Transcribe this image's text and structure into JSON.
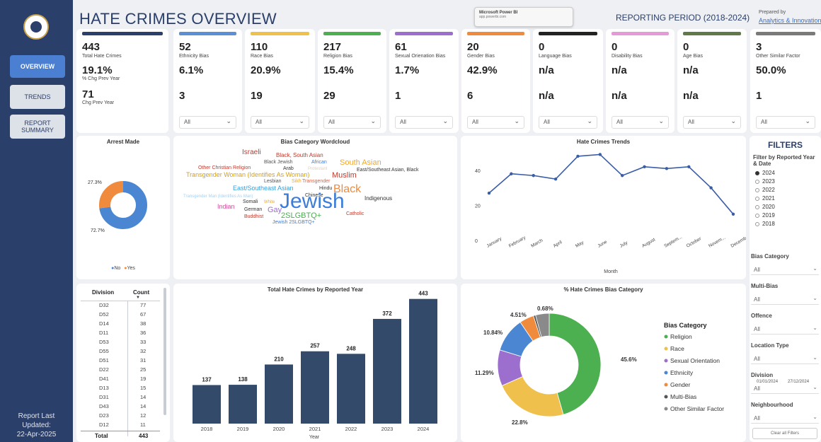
{
  "header": {
    "title": "HATE CRIMES OVERVIEW",
    "reporting_period": "REPORTING PERIOD (2018-2024)",
    "prepared_by": "Prepared by",
    "prepared_link": "Analytics & Innovation",
    "popup_title": "Microsoft Power BI",
    "popup_url": "app.powerbi.com"
  },
  "sidebar": {
    "nav": [
      {
        "label": "OVERVIEW",
        "active": true
      },
      {
        "label": "TRENDS",
        "active": false
      },
      {
        "label": "REPORT SUMMARY",
        "active": false
      }
    ],
    "updated_label": "Report Last Updated:",
    "updated_date": "22-Apr-2025"
  },
  "kpis": [
    {
      "count": "443",
      "label": "Total Hate Crimes",
      "pct": "19.1%",
      "pct_label": "% Chg Prev Year",
      "chg": "71",
      "chg_label": "Chg Prev Year",
      "color": "#2b3f6b",
      "dropdown": ""
    },
    {
      "count": "52",
      "label": "Ethnicity Bias",
      "pct": "6.1%",
      "chg": "3",
      "color": "#5b8fd6",
      "dropdown": "All"
    },
    {
      "count": "110",
      "label": "Race Bias",
      "pct": "20.9%",
      "chg": "19",
      "color": "#f0c04c",
      "dropdown": "All"
    },
    {
      "count": "217",
      "label": "Religion Bias",
      "pct": "15.4%",
      "chg": "29",
      "color": "#4caf50",
      "dropdown": "All"
    },
    {
      "count": "61",
      "label": "Sexual Orienation Bias",
      "pct": "1.7%",
      "chg": "1",
      "color": "#9c6fcf",
      "dropdown": "All"
    },
    {
      "count": "20",
      "label": "Gender Bias",
      "pct": "42.9%",
      "chg": "6",
      "color": "#f08a3c",
      "dropdown": "All"
    },
    {
      "count": "0",
      "label": "Language Bias",
      "pct": "n/a",
      "chg": "n/a",
      "color": "#222222",
      "dropdown": "All"
    },
    {
      "count": "0",
      "label": "Disability Bias",
      "pct": "n/a",
      "chg": "n/a",
      "color": "#e39ad6",
      "dropdown": "All"
    },
    {
      "count": "0",
      "label": "Age Bias",
      "pct": "n/a",
      "chg": "n/a",
      "color": "#5f7a48",
      "dropdown": "All"
    },
    {
      "count": "3",
      "label": "Other Similar Factor",
      "pct": "50.0%",
      "chg": "1",
      "color": "#7a7a7a",
      "dropdown": "All"
    }
  ],
  "arrest": {
    "title": "Arrest Made",
    "legend_no": "No",
    "legend_yes": "Yes",
    "no_label": "72.7%",
    "yes_label": "27.3%",
    "color_no": "#4a86d1",
    "color_yes": "#f08a3c"
  },
  "wordcloud": {
    "title": "Bias Category Wordcloud",
    "words": [
      {
        "text": "Israeli",
        "color": "#c0392b"
      },
      {
        "text": "Black, South Asian",
        "color": "#c0392b"
      },
      {
        "text": "Black Jewish",
        "color": "#555"
      },
      {
        "text": "African",
        "color": "#3b7dd8"
      },
      {
        "text": "South Asian",
        "color": "#f0a830"
      },
      {
        "text": "Other Christian Religion",
        "color": "#c0392b"
      },
      {
        "text": "Arab",
        "color": "#333"
      },
      {
        "text": "Protestant",
        "color": "#e0d0c0"
      },
      {
        "text": "East/Southeast Asian, Black",
        "color": "#333"
      },
      {
        "text": "Transgender Woman (Identifies As Woman)",
        "color": "#d4a017"
      },
      {
        "text": "Muslim",
        "color": "#c0392b"
      },
      {
        "text": "Lesbian",
        "color": "#555"
      },
      {
        "text": "Sikh",
        "color": "#f0a830"
      },
      {
        "text": "Transgender",
        "color": "#e06040"
      },
      {
        "text": "East/Southeast Asian",
        "color": "#3b9fd8"
      },
      {
        "text": "Hindu",
        "color": "#333"
      },
      {
        "text": "Black",
        "color": "#f08a3c"
      },
      {
        "text": "Transgender Man (Identifies As Man)",
        "color": "#a8d0f0"
      },
      {
        "text": "Chinese",
        "color": "#333"
      },
      {
        "text": "Indigenous",
        "color": "#333"
      },
      {
        "text": "Indian",
        "color": "#d64d9a"
      },
      {
        "text": "Somali",
        "color": "#333"
      },
      {
        "text": "White",
        "color": "#f0a830"
      },
      {
        "text": "Jewish",
        "color": "#3b7dd8"
      },
      {
        "text": "German",
        "color": "#333"
      },
      {
        "text": "Gay",
        "color": "#9c6fcf"
      },
      {
        "text": "2SLGBTQ+",
        "color": "#4caf50"
      },
      {
        "text": "Catholic",
        "color": "#c0392b"
      },
      {
        "text": "Buddhist",
        "color": "#c0392b"
      },
      {
        "text": "Jewish 2SLGBTQ+",
        "color": "#3b7dd8"
      }
    ]
  },
  "trends": {
    "title": "Hate Crimes Trends",
    "xlabel": "Month",
    "yticks": [
      "0",
      "20",
      "40"
    ],
    "months": [
      "January",
      "February",
      "March",
      "April",
      "May",
      "June",
      "July",
      "August",
      "Septem...",
      "October",
      "Novem...",
      "Decemb..."
    ],
    "values": [
      27,
      38,
      37,
      35,
      48,
      49,
      37,
      42,
      41,
      42,
      30,
      15
    ]
  },
  "division_table": {
    "col_division": "Division",
    "col_count": "Count",
    "rows": [
      [
        "D32",
        "77"
      ],
      [
        "D52",
        "67"
      ],
      [
        "D14",
        "38"
      ],
      [
        "D11",
        "36"
      ],
      [
        "D53",
        "33"
      ],
      [
        "D55",
        "32"
      ],
      [
        "D51",
        "31"
      ],
      [
        "D22",
        "25"
      ],
      [
        "D41",
        "19"
      ],
      [
        "D13",
        "15"
      ],
      [
        "D31",
        "14"
      ],
      [
        "D43",
        "14"
      ],
      [
        "D23",
        "12"
      ],
      [
        "D12",
        "11"
      ]
    ],
    "total_label": "Total",
    "total_value": "443"
  },
  "yearly": {
    "title": "Total Hate Crimes by Reported Year",
    "xlabel": "Year",
    "years": [
      "2018",
      "2019",
      "2020",
      "2021",
      "2022",
      "2023",
      "2024"
    ],
    "values": [
      137,
      138,
      210,
      257,
      248,
      372,
      443
    ],
    "color": "#344a6b"
  },
  "bias_pie": {
    "title": "% Hate Crimes Bias Category",
    "legend_title": "Bias Category",
    "slices": [
      {
        "name": "Religion",
        "value": 45.6,
        "label": "45.6%",
        "color": "#4caf50"
      },
      {
        "name": "Race",
        "value": 22.8,
        "label": "22.8%",
        "color": "#f0c04c"
      },
      {
        "name": "Sexual Orientation",
        "value": 11.29,
        "label": "11.29%",
        "color": "#9c6fcf"
      },
      {
        "name": "Ethnicity",
        "value": 10.84,
        "label": "10.84%",
        "color": "#4a86d1"
      },
      {
        "name": "Gender",
        "value": 4.51,
        "label": "4.51%",
        "color": "#f08a3c"
      },
      {
        "name": "Multi-Bias",
        "value": 0.68,
        "label": "0.68%",
        "color": "#555555"
      },
      {
        "name": "Other Similar Factor",
        "value": 4.28,
        "label": "",
        "color": "#8a8a8a"
      }
    ]
  },
  "filters": {
    "title": "FILTERS",
    "subtitle": "Filter by Reported Year & Date",
    "years": [
      "2024",
      "2023",
      "2022",
      "2021",
      "2020",
      "2019",
      "2018"
    ],
    "selected_year": "2024",
    "date_from": "01/01/2024",
    "date_to": "27/12/2024",
    "dropdowns": [
      {
        "label": "Bias Category",
        "value": "All"
      },
      {
        "label": "Multi-Bias",
        "value": "All"
      },
      {
        "label": "Offence",
        "value": "All"
      },
      {
        "label": "Location Type",
        "value": "All"
      },
      {
        "label": "Division",
        "value": "All"
      },
      {
        "label": "Neighbourhood",
        "value": "All"
      }
    ],
    "clear_label": "Clear all Filters"
  }
}
